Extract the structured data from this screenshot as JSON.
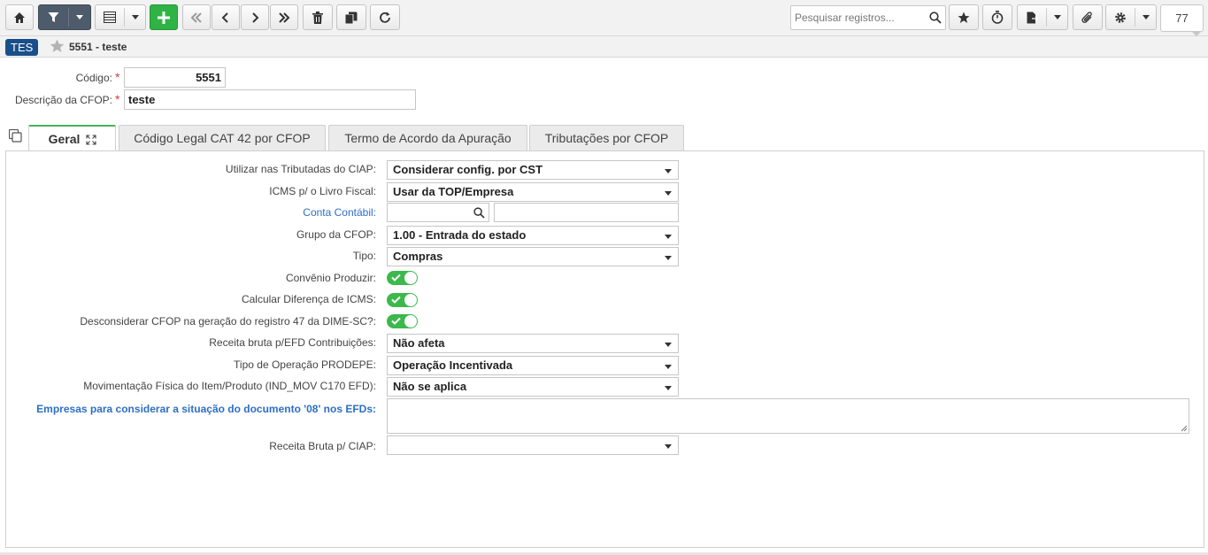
{
  "toolbar": {
    "search_placeholder": "Pesquisar registros...",
    "record_count": "77",
    "icons": [
      "home-icon",
      "filter-icon",
      "grid-icon",
      "add-icon",
      "first-icon",
      "prev-icon",
      "next-icon",
      "last-icon",
      "delete-icon",
      "copy-icon",
      "refresh-icon",
      "search-icon",
      "star-icon",
      "timer-icon",
      "export-icon",
      "attach-icon",
      "gear-icon"
    ]
  },
  "header": {
    "badge": "TES",
    "title": "5551 - teste"
  },
  "form": {
    "codigo_label": "Código:",
    "codigo_value": "5551",
    "descricao_label": "Descrição da CFOP:",
    "descricao_value": "teste"
  },
  "tabs": [
    {
      "label": "Geral"
    },
    {
      "label": "Código Legal CAT 42 por CFOP"
    },
    {
      "label": "Termo de Acordo da Apuração"
    },
    {
      "label": "Tributações por CFOP"
    }
  ],
  "geral": {
    "ciap_label": "Utilizar nas Tributadas do CIAP:",
    "ciap_value": "Considerar config. por CST",
    "icms_livro_label": "ICMS p/ o Livro Fiscal:",
    "icms_livro_value": "Usar da TOP/Empresa",
    "conta_label": "Conta Contábil:",
    "conta_value": "",
    "conta_desc": "",
    "grupo_label": "Grupo da CFOP:",
    "grupo_value": "1.00 - Entrada do estado",
    "tipo_label": "Tipo:",
    "tipo_value": "Compras",
    "convenio_label": "Convênio Produzir:",
    "convenio_on": true,
    "dif_icms_label": "Calcular Diferença de ICMS:",
    "dif_icms_on": true,
    "dime_label": "Desconsiderar CFOP na geração do registro 47 da DIME-SC?:",
    "dime_on": true,
    "receita_efd_label": "Receita bruta p/EFD Contribuições:",
    "receita_efd_value": "Não afeta",
    "prodepe_label": "Tipo de Operação PRODEPE:",
    "prodepe_value": "Operação Incentivada",
    "mov_label": "Movimentação Física do Item/Produto (IND_MOV C170 EFD):",
    "mov_value": "Não se aplica",
    "empresas_label": "Empresas para considerar a situação do documento '08' nos EFDs:",
    "empresas_value": "",
    "receita_ciap_label": "Receita Bruta p/ CIAP:",
    "receita_ciap_value": ""
  },
  "colors": {
    "accent_green": "#3cb84d",
    "badge_blue": "#1a4f8b",
    "link_blue": "#2d6fc4",
    "required_red": "#d9383a",
    "filter_dark": "#4d5b6b"
  }
}
